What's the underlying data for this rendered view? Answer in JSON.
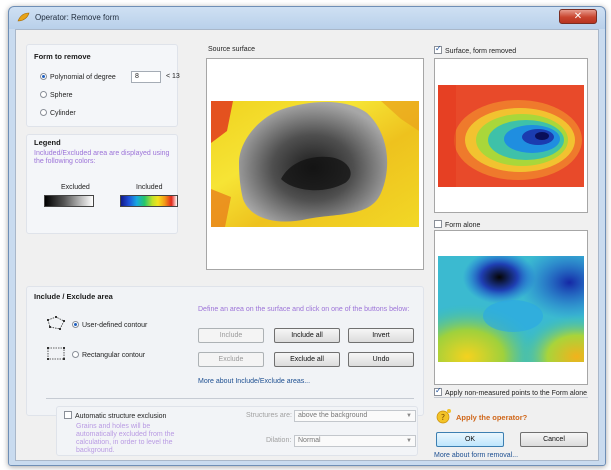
{
  "window": {
    "title": "Operator: Remove form",
    "close_label": "✕"
  },
  "form_to_remove": {
    "title": "Form to remove",
    "options": [
      {
        "label": "Polynomial of degree",
        "selected": true
      },
      {
        "label": "Sphere",
        "selected": false
      },
      {
        "label": "Cylinder",
        "selected": false
      }
    ],
    "degree_value": "8",
    "degree_limit": "< 13"
  },
  "legend": {
    "title": "Legend",
    "description": "Included/Excluded area are displayed using the following colors:",
    "excluded_label": "Excluded",
    "included_label": "Included"
  },
  "previews": {
    "source_label": "Source surface",
    "surface_removed_label": "Surface, form removed",
    "surface_removed_checked": true,
    "form_alone_label": "Form alone",
    "form_alone_checked": false
  },
  "include_exclude": {
    "title": "Include / Exclude area",
    "hint": "Define an area on the surface and click on one of the buttons below:",
    "contour_options": [
      {
        "label": "User-defined contour",
        "selected": true
      },
      {
        "label": "Rectangular contour",
        "selected": false
      }
    ],
    "buttons": {
      "include": "Include",
      "include_all": "Include all",
      "invert": "Invert",
      "exclude": "Exclude",
      "exclude_all": "Exclude all",
      "undo": "Undo"
    },
    "more_link": "More about Include/Exclude areas..."
  },
  "structure": {
    "checkbox_label": "Automatic structure exclusion",
    "checked": false,
    "hint": "Grains and holes will be automatically excluded from the calculation, in order to level the background.",
    "structures_label": "Structures are:",
    "structures_value": "above the background",
    "dilation_label": "Dilation:",
    "dilation_value": "Normal"
  },
  "apply_nonmeasured": {
    "label": "Apply non-measured points to the Form alone",
    "checked": true
  },
  "footer": {
    "apply_question": "Apply the operator?",
    "ok_label": "OK",
    "cancel_label": "Cancel",
    "more_link": "More about form removal..."
  },
  "colors": {
    "accent": "#1f5fbf",
    "hint": "#9c73d8",
    "link": "#1d4f91",
    "apply": "#d0671a"
  }
}
